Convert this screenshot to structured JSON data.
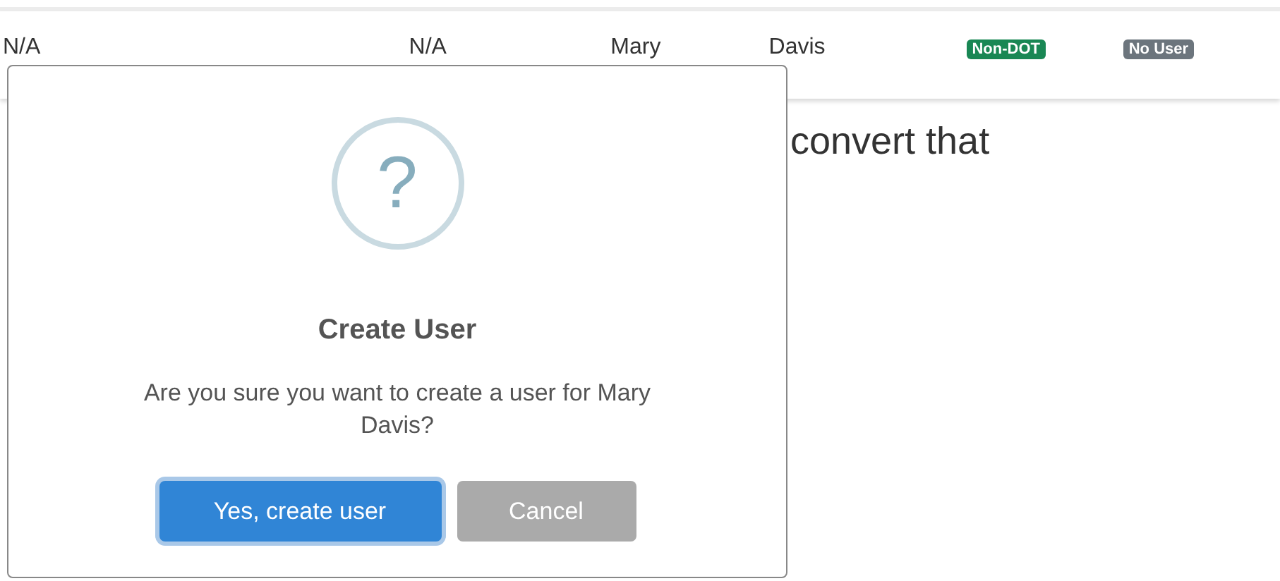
{
  "row": {
    "cells": [
      "N/A",
      "N/A",
      "Mary",
      "Davis"
    ],
    "badges": [
      {
        "label": "Non-DOT",
        "color": "#198754"
      },
      {
        "label": "No User",
        "color": "#6c757d"
      }
    ]
  },
  "background_text": "convert that",
  "dialog": {
    "icon": "?",
    "title": "Create User",
    "message": "Are you sure you want to create a user for Mary Davis?",
    "buttons": [
      {
        "label": "Yes, create user",
        "kind": "confirm",
        "focused": true
      },
      {
        "label": "Cancel",
        "kind": "cancel",
        "focused": false
      }
    ]
  }
}
